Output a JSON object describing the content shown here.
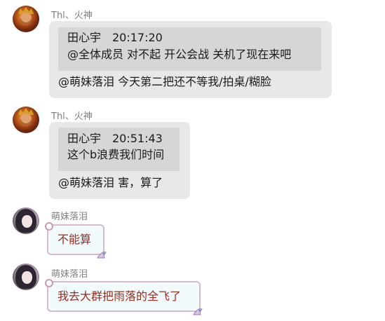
{
  "messages": [
    {
      "sender": "Thl、火神",
      "quote_header": "田心宇　20:17:20",
      "quote_text": "@全体成员 对不起  开公会战  关机了现在来吧",
      "reply": "@萌妹落泪 今天第二把还不等我/拍桌/糊脸"
    },
    {
      "sender": "Thl、火神",
      "quote_header": "田心宇　20:51:43",
      "quote_text": "这个b浪费我们时间",
      "reply": "@萌妹落泪 害，算了"
    },
    {
      "sender": "萌妹落泪",
      "text": "不能算"
    },
    {
      "sender": "萌妹落泪",
      "text": "我去大群把雨落的全飞了"
    }
  ],
  "colors": {
    "gray_bubble": "#e8e8e8",
    "quote_block": "#d6d6d6",
    "pink_bubble_bg": "#f1fbfc",
    "pink_bubble_border": "#d8b8ce",
    "pink_text": "#9a2c1c",
    "sender_text": "#808080"
  }
}
